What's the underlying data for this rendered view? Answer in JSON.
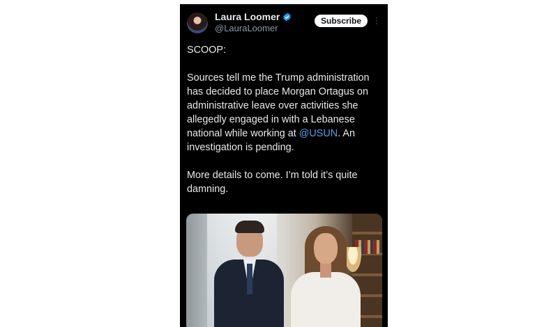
{
  "profile": {
    "display_name": "Laura Loomer",
    "handle": "@LauraLoomer",
    "verified": true
  },
  "header": {
    "subscribe_label": "Subscribe",
    "more_icon": "more-vertical-icon"
  },
  "tweet": {
    "lines_1": "SCOOP:",
    "para_2_before_mention": "Sources tell me the Trump administration has decided to place Morgan Ortagus on administrative leave over activities she allegedly engaged in with a Lebanese national while working at ",
    "mention": "@USUN",
    "para_2_after_mention": ". An investigation is pending.",
    "para_3": "More details to come. I’m told it’s quite damning."
  },
  "colors": {
    "background": "#000000",
    "text": "#e7e9ea",
    "muted": "#8b98a5",
    "mention": "#5a9ee8",
    "verified": "#1d9bf0"
  }
}
